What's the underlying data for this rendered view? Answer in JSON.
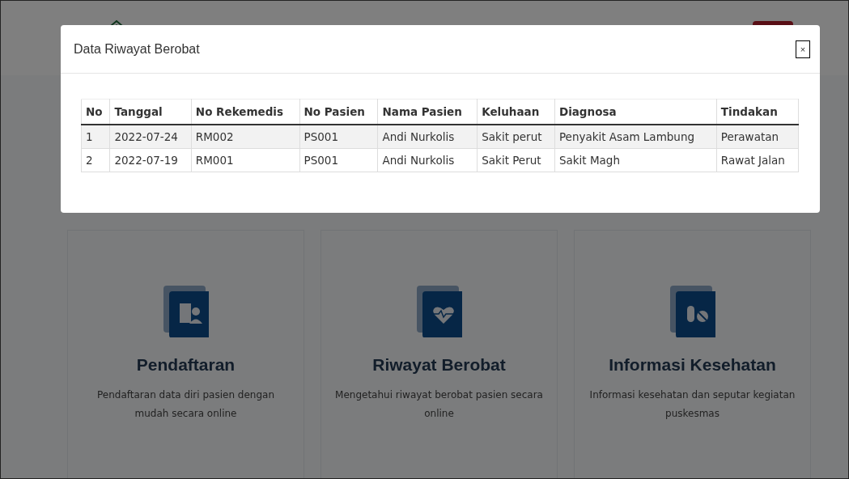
{
  "modal": {
    "title": "Data Riwayat Berobat",
    "close_label": "×",
    "table": {
      "columns": [
        "No",
        "Tanggal",
        "No Rekemedis",
        "No Pasien",
        "Nama Pasien",
        "Keluhaan",
        "Diagnosa",
        "Tindakan"
      ],
      "rows": [
        [
          "1",
          "2022-07-24",
          "RM002",
          "PS001",
          "Andi Nurkolis",
          "Sakit perut",
          "Penyakit Asam Lambung",
          "Perawatan"
        ],
        [
          "2",
          "2022-07-19",
          "RM001",
          "PS001",
          "Andi Nurkolis",
          "Sakit Perut",
          "Sakit Magh",
          "Rawat Jalan"
        ]
      ]
    }
  },
  "cards": [
    {
      "kind": "registration",
      "title": "Pendaftaran",
      "text": "Pendaftaran data diri pasien dengan mudah secara online"
    },
    {
      "kind": "history",
      "title": "Riwayat Berobat",
      "text": "Mengetahui riwayat berobat pasien secara online"
    },
    {
      "kind": "info",
      "title": "Informasi Kesehatan",
      "text": "Informasi kesehatan dan seputar kegiatan puskesmas"
    }
  ]
}
